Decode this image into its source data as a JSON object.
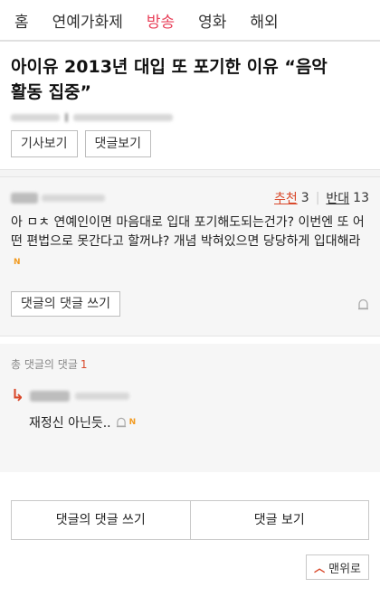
{
  "nav": {
    "items": [
      "홈",
      "연예가화제",
      "방송",
      "영화",
      "해외"
    ],
    "active_index": 2
  },
  "article": {
    "title_line1": "아이유 2013년 대입 또 포기한 이유 “음악",
    "title_line2": "활동 집중”",
    "view_article_label": "기사보기",
    "view_comments_label": "댓글보기"
  },
  "comment": {
    "upvote_label": "추천",
    "upvote_count": "3",
    "downvote_label": "반대",
    "downvote_count": "13",
    "text": "아 ㅁㅊ 연예인이면 마음대로 입대 포기해도되는건가? 이번엔 또 어떤 편법으로 못간다고 할꺼냐? 개념 박혀있으면 당당하게 입대해라",
    "new_badge": "N",
    "reply_button_label": "댓글의 댓글 쓰기"
  },
  "replies": {
    "count_label": "총 댓글의 댓글",
    "count": "1",
    "items": [
      {
        "text": "재정신 아닌듯..",
        "new_badge": "N"
      }
    ]
  },
  "footer": {
    "write_reply_label": "댓글의 댓글 쓰기",
    "view_comments_label": "댓글 보기",
    "top_label": "맨위로"
  },
  "colors": {
    "accent": "#e8415a",
    "vote": "#d9492b",
    "badge": "#f29a1f"
  },
  "icons": [
    "report-icon",
    "up-caret-icon",
    "reply-arrow-icon"
  ]
}
